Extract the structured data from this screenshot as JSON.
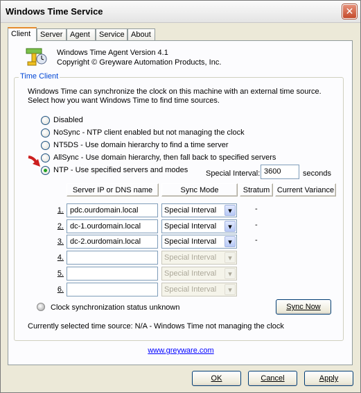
{
  "window": {
    "title": "Windows Time Service",
    "close_glyph": "✕"
  },
  "tabs": [
    {
      "label": "Client",
      "active": true
    },
    {
      "label": "Server",
      "active": false
    },
    {
      "label": "Agent",
      "active": false
    },
    {
      "label": "Service",
      "active": false
    },
    {
      "label": "About",
      "active": false
    }
  ],
  "about": {
    "line1": "Windows Time Agent Version 4.1",
    "line2": "Copyright © Greyware Automation Products, Inc."
  },
  "time_client": {
    "legend": "Time Client",
    "desc1": "Windows Time can synchronize the clock on this machine with an external time source.",
    "desc2": "Select how you want Windows Time to find time sources.",
    "options": [
      {
        "label": "Disabled",
        "checked": false
      },
      {
        "label": "NoSync - NTP client enabled but not managing the clock",
        "checked": false
      },
      {
        "label": "NT5DS - Use domain hierarchy to find a time server",
        "checked": false
      },
      {
        "label": "AllSync - Use domain hierarchy, then fall back to specified servers",
        "checked": false
      },
      {
        "label": "NTP - Use specified servers and modes",
        "checked": true
      }
    ],
    "special_interval_label": "Special Interval:",
    "special_interval_value": "3600",
    "special_interval_unit": "seconds"
  },
  "servers": {
    "headers": [
      "Server IP or DNS name",
      "Sync Mode",
      "Stratum",
      "Current Variance"
    ],
    "rows": [
      {
        "num": "1.",
        "ip": "pdc.ourdomain.local",
        "mode": "Special Interval",
        "stratum": "-",
        "enabled": true
      },
      {
        "num": "2.",
        "ip": "dc-1.ourdomain.local",
        "mode": "Special Interval",
        "stratum": "-",
        "enabled": true
      },
      {
        "num": "3.",
        "ip": "dc-2.ourdomain.local",
        "mode": "Special Interval",
        "stratum": "-",
        "enabled": true
      },
      {
        "num": "4.",
        "ip": "",
        "mode": "Special Interval",
        "stratum": "",
        "enabled": false
      },
      {
        "num": "5.",
        "ip": "",
        "mode": "Special Interval",
        "stratum": "",
        "enabled": false
      },
      {
        "num": "6.",
        "ip": "",
        "mode": "Special Interval",
        "stratum": "",
        "enabled": false
      }
    ],
    "dropdown_glyph": "▾"
  },
  "status": {
    "label": "Clock synchronization status unknown",
    "sync_now": "Sync Now",
    "current_source": "Currently selected time source: N/A - Windows Time not managing the clock"
  },
  "link": "www.greyware.com",
  "buttons": {
    "ok": "OK",
    "cancel": "Cancel",
    "apply": "Apply"
  },
  "colors": {
    "accent_tab": "#e68b2c",
    "legend": "#0046d5",
    "arrow": "#cc1f1f",
    "checked": "#21a121"
  },
  "icons": [
    "close-icon",
    "app-icon",
    "red-arrow-icon",
    "dropdown-arrow-icon",
    "status-dot-icon"
  ]
}
